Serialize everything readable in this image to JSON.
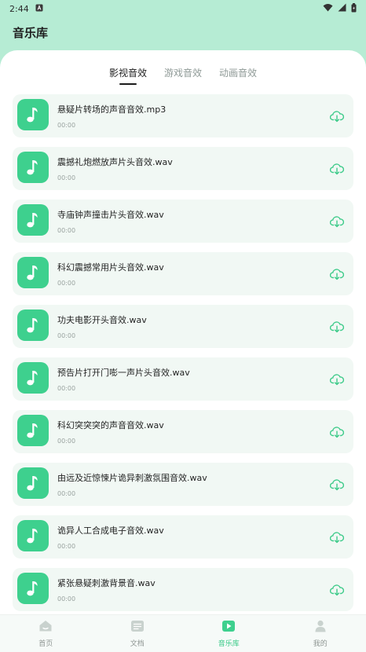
{
  "status_bar": {
    "time": "2:44"
  },
  "app": {
    "title": "音乐库"
  },
  "tabs": [
    {
      "label": "影视音效",
      "active": true
    },
    {
      "label": "游戏音效",
      "active": false
    },
    {
      "label": "动画音效",
      "active": false
    }
  ],
  "tracks": [
    {
      "title": "悬疑片转场的声音音效.mp3",
      "duration": "00:00"
    },
    {
      "title": "震撼礼炮燃放声片头音效.wav",
      "duration": "00:00"
    },
    {
      "title": "寺庙钟声撞击片头音效.wav",
      "duration": "00:00"
    },
    {
      "title": "科幻震撼常用片头音效.wav",
      "duration": "00:00"
    },
    {
      "title": "功夫电影开头音效.wav",
      "duration": "00:00"
    },
    {
      "title": "预告片打开门嘭一声片头音效.wav",
      "duration": "00:00"
    },
    {
      "title": "科幻突突突的声音音效.wav",
      "duration": "00:00"
    },
    {
      "title": "由远及近惊悚片诡异刺激氛围音效.wav",
      "duration": "00:00"
    },
    {
      "title": "诡异人工合成电子音效.wav",
      "duration": "00:00"
    },
    {
      "title": "紧张悬疑刺激背景音.wav",
      "duration": "00:00"
    }
  ],
  "nav": [
    {
      "label": "首页",
      "icon": "home-icon",
      "active": false
    },
    {
      "label": "文档",
      "icon": "document-icon",
      "active": false
    },
    {
      "label": "音乐库",
      "icon": "music-library-icon",
      "active": true
    },
    {
      "label": "我的",
      "icon": "profile-icon",
      "active": false
    }
  ],
  "colors": {
    "accent": "#3ed08e",
    "header_bg": "#b6ecd4",
    "card_bg": "#f1f8f4"
  }
}
